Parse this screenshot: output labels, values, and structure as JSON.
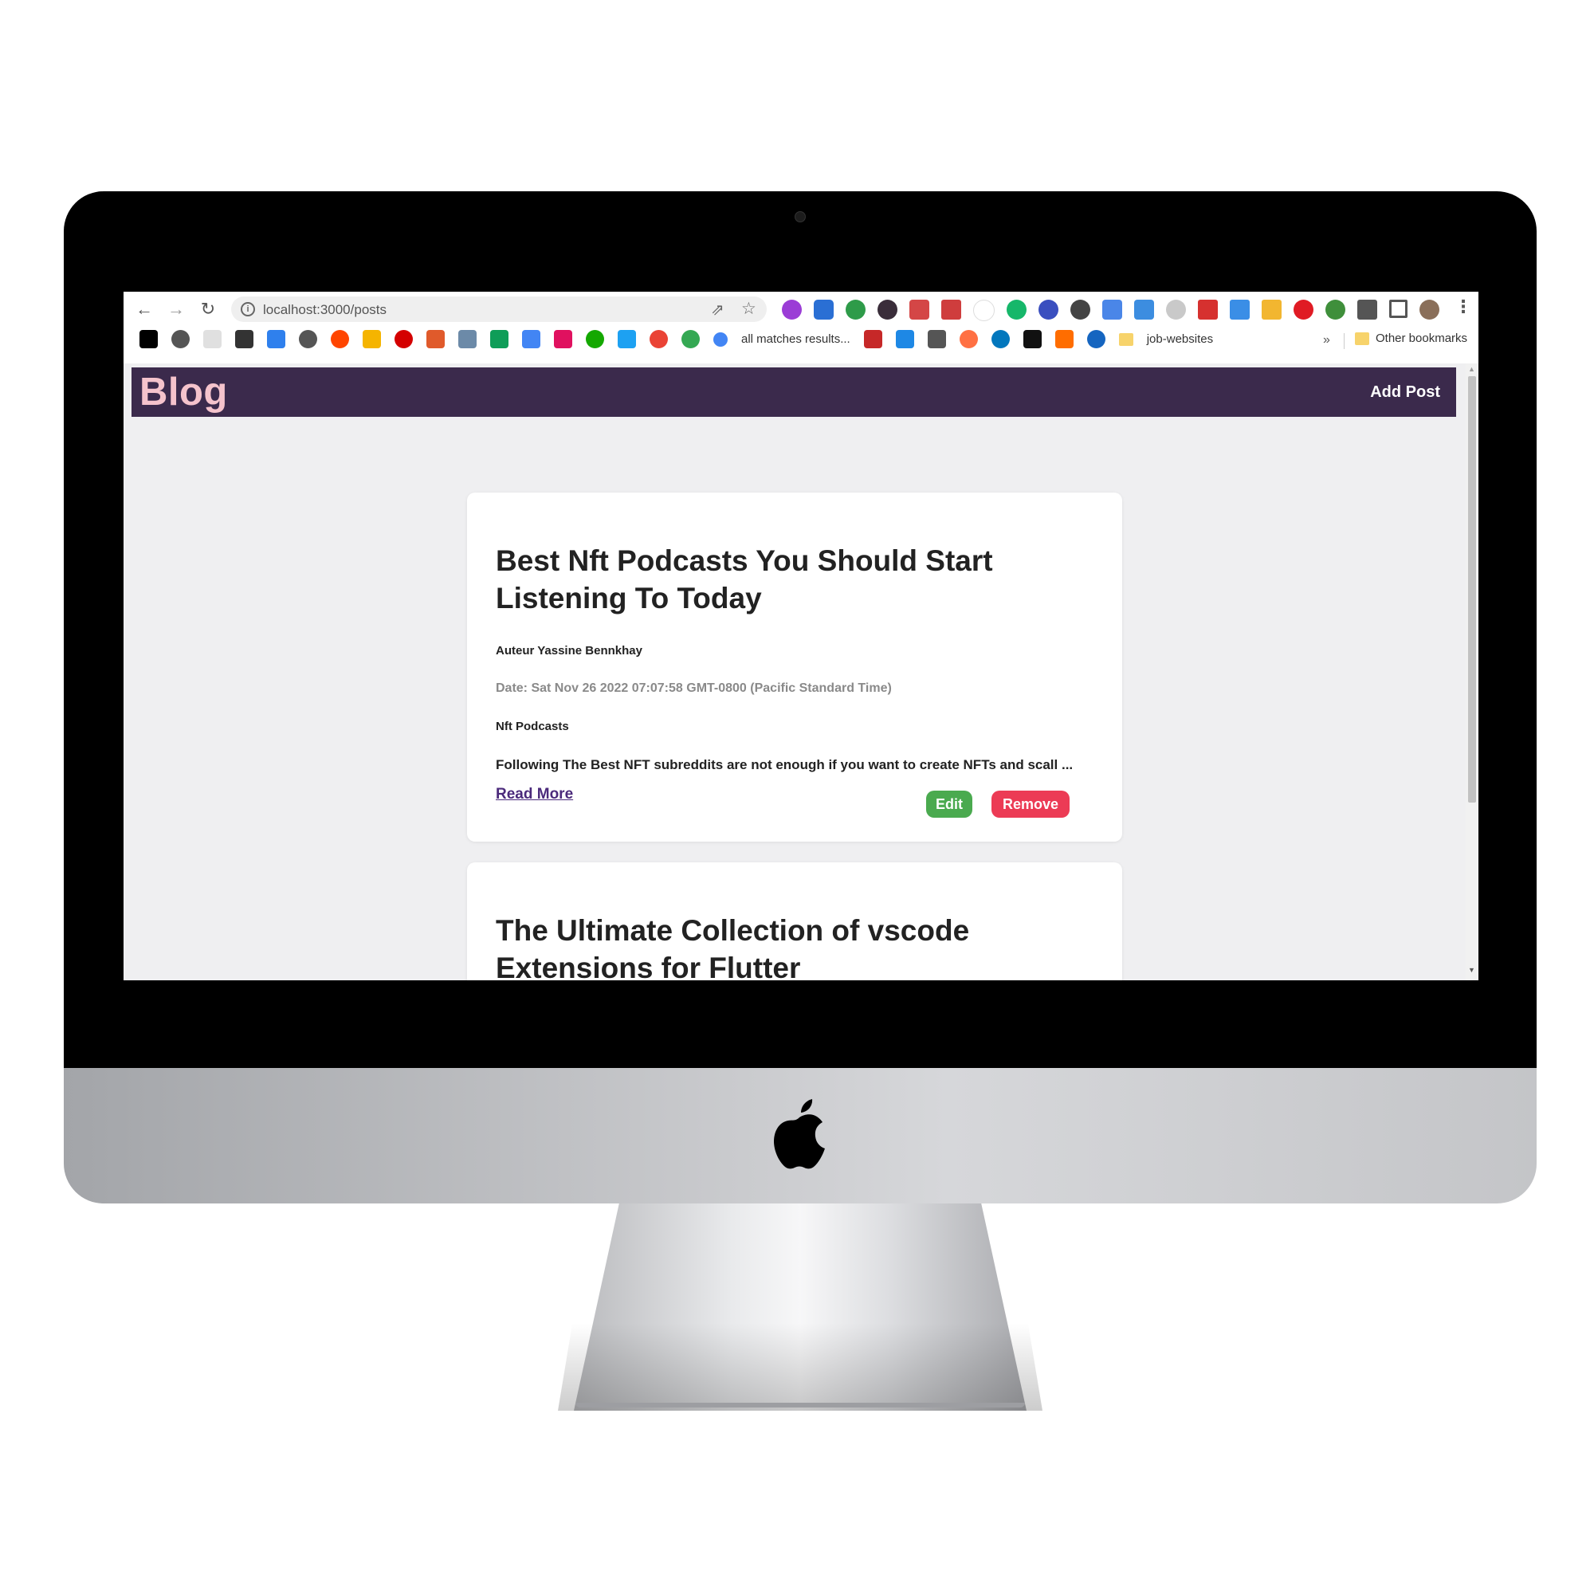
{
  "browser": {
    "url": "localhost:3000/posts",
    "bookmarks": {
      "all_matches": "all matches results...",
      "job_websites": "job-websites",
      "more": "»",
      "other_bookmarks": "Other bookmarks"
    }
  },
  "app": {
    "brand": "Blog",
    "add_post": "Add Post"
  },
  "posts": [
    {
      "title": "Best Nft Podcasts You Should Start Listening To Today",
      "author": "Auteur Yassine Bennkhay",
      "date": "Date: Sat Nov 26 2022 07:07:58 GMT-0800 (Pacific Standard Time)",
      "category": "Nft Podcasts",
      "excerpt": "Following The Best NFT subreddits are not enough if you want to create NFTs and scall ...",
      "read_more": "Read More",
      "edit": "Edit",
      "remove": "Remove"
    },
    {
      "title": "The Ultimate Collection of vscode Extensions for Flutter"
    }
  ],
  "colors": {
    "appbar": "#3b2a4c",
    "brand": "#f5c3cc",
    "edit": "#4aaa4f",
    "remove": "#ec3b55",
    "link": "#4b2a7b",
    "page_bg": "#efeff1"
  }
}
